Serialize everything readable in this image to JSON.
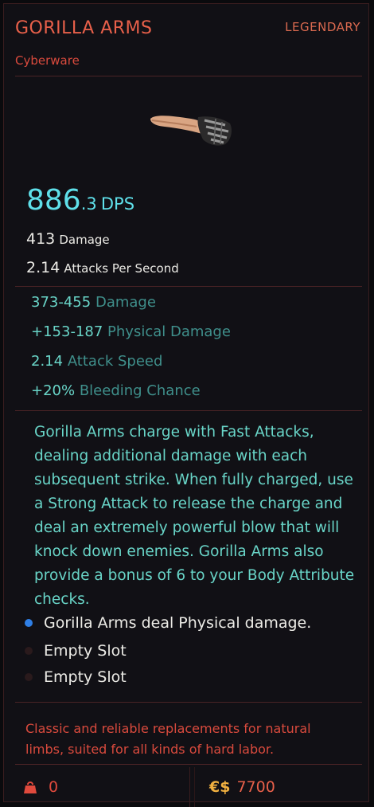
{
  "item": {
    "name": "GORILLA ARMS",
    "rarity": "LEGENDARY",
    "category": "Cyberware",
    "image_icon": "gorilla-arm-fist-icon"
  },
  "dps": {
    "whole": "886",
    "fraction": ".3",
    "unit": "DPS"
  },
  "stats": [
    {
      "value": "413",
      "label": "Damage"
    },
    {
      "value": "2.14",
      "label": "Attacks Per Second"
    }
  ],
  "modifiers": [
    {
      "value": "373-455",
      "label": "Damage"
    },
    {
      "value": "+153-187",
      "label": "Physical Damage"
    },
    {
      "value": "2.14",
      "label": "Attack Speed"
    },
    {
      "value": "+20%",
      "label": "Bleeding Chance"
    }
  ],
  "description": "Gorilla Arms charge with Fast Attacks, dealing additional damage with each subsequent strike. When fully charged, use a Strong Attack to release the charge and deal an extremely powerful blow that will knock down enemies. Gorilla Arms also provide a bonus of 6 to your Body Attribute checks.",
  "slots": [
    {
      "label": "Gorilla Arms deal Physical damage.",
      "filled": true
    },
    {
      "label": "Empty Slot",
      "filled": false
    },
    {
      "label": "Empty Slot",
      "filled": false
    }
  ],
  "flavor": "Classic and reliable replacements for natural limbs, suited for all kinds of hard labor.",
  "footer": {
    "weight_icon": "weight-bag-icon",
    "weight": "0",
    "currency_symbol": "€$",
    "price": "7700"
  },
  "colors": {
    "accent": "#e8604a",
    "cyan": "#5fe0ea",
    "mod_value": "#69d5c8",
    "mod_label": "#3f8f8b",
    "slot_filled": "#2f7fe6",
    "slot_empty": "#2a1a1c"
  }
}
